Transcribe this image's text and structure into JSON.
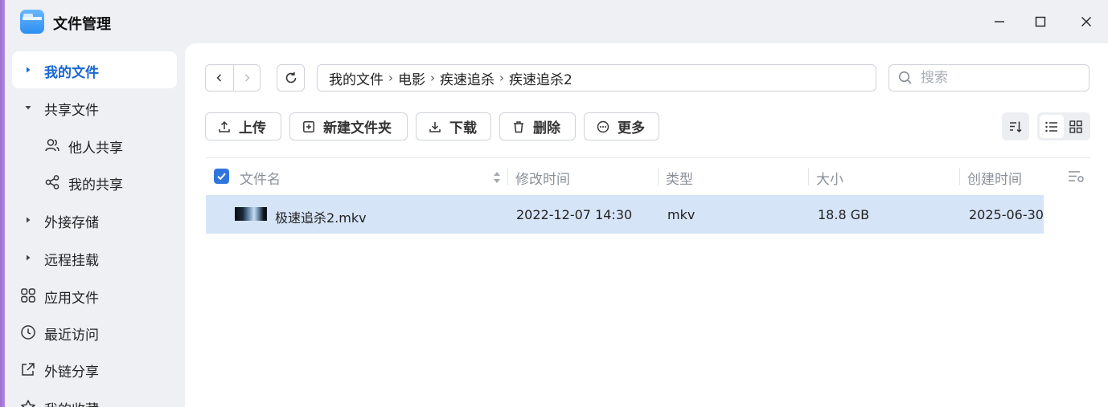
{
  "app": {
    "title": "文件管理"
  },
  "sidebar": {
    "items": [
      {
        "label": "我的文件"
      },
      {
        "label": "共享文件"
      },
      {
        "label": "他人共享"
      },
      {
        "label": "我的共享"
      },
      {
        "label": "外接存储"
      },
      {
        "label": "远程挂载"
      },
      {
        "label": "应用文件"
      },
      {
        "label": "最近访问"
      },
      {
        "label": "外链分享"
      },
      {
        "label": "我的收藏"
      }
    ]
  },
  "breadcrumb": [
    "我的文件",
    "电影",
    "疾速追杀",
    "疾速追杀2"
  ],
  "search": {
    "placeholder": "搜索"
  },
  "toolbar": {
    "upload": "上传",
    "new_folder": "新建文件夹",
    "download": "下载",
    "delete": "删除",
    "more": "更多"
  },
  "table": {
    "columns": [
      "文件名",
      "修改时间",
      "类型",
      "大小",
      "创建时间"
    ],
    "rows": [
      {
        "name": "极速追杀2.mkv",
        "modified": "2022-12-07 14:30",
        "type": "mkv",
        "size": "18.8 GB",
        "created": "2025-06-30"
      }
    ]
  },
  "colors": {
    "accent": "#1a66d2",
    "selected_row": "#d6e4f7",
    "checkbox": "#2f75dd"
  }
}
